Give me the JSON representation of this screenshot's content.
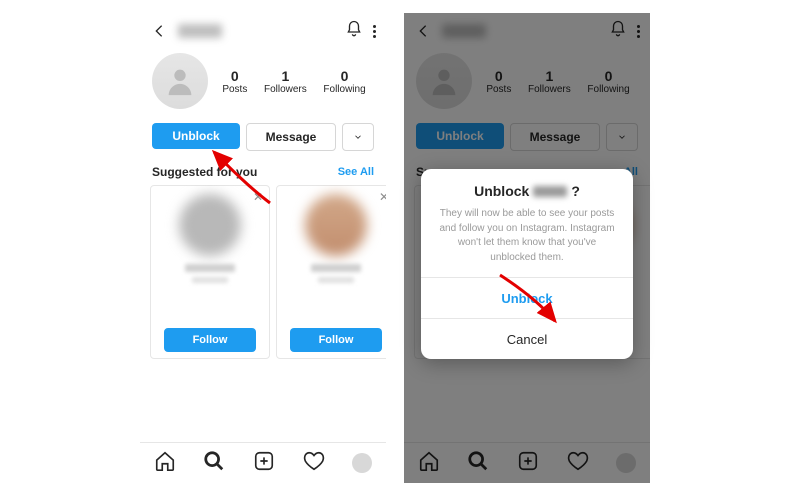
{
  "profile": {
    "stats": {
      "posts": {
        "value": "0",
        "label": "Posts"
      },
      "followers": {
        "value": "1",
        "label": "Followers"
      },
      "following": {
        "value": "0",
        "label": "Following"
      }
    },
    "buttons": {
      "unblock": "Unblock",
      "message": "Message"
    }
  },
  "profile2": {
    "stats": {
      "posts": {
        "value": "0",
        "label": "Posts"
      },
      "followers": {
        "value": "1",
        "label": "Followers"
      },
      "following": {
        "value": "0",
        "label": "Following"
      }
    },
    "buttons": {
      "unblock": "Unblock",
      "message": "Message"
    }
  },
  "suggested": {
    "title": "Suggested for you",
    "see_all": "See All",
    "follow": "Follow"
  },
  "suggested2": {
    "title": "Sugg",
    "see_all": "ee All"
  },
  "dialog": {
    "title_prefix": "Unblock",
    "title_suffix": "?",
    "body": "They will now be able to see your posts and follow you on Instagram. Instagram won't let them know that you've unblocked them.",
    "confirm": "Unblock",
    "cancel": "Cancel"
  }
}
